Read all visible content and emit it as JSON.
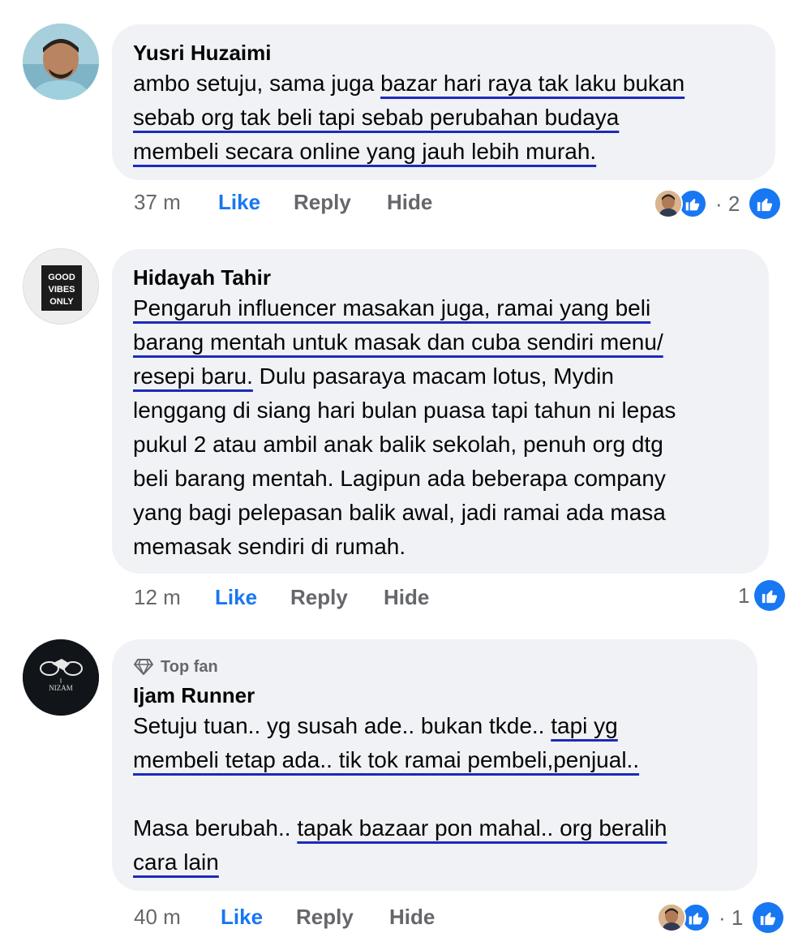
{
  "comments": [
    {
      "author": "Yusri Huzaimi",
      "text_plain_1": "ambo setuju, sama juga ",
      "text_ul_1": "bazar hari raya tak laku bukan",
      "text_ul_2": "sebab org tak beli tapi sebab perubahan budaya ",
      "text_ul_3": "membeli secara online yang jauh lebih murah.",
      "time": "37 m",
      "like": "Like",
      "reply": "Reply",
      "hide": "Hide",
      "reaction_count": "· 2"
    },
    {
      "author": "Hidayah Tahir",
      "text_ul_1": "Pengaruh influencer masakan juga, ramai yang beli ",
      "text_ul_2": "barang mentah untuk masak dan cuba sendiri menu/",
      "text_ul_3": "resepi baru.",
      "text_plain_3": " Dulu pasaraya macam lotus, Mydin",
      "text_line_4": "lenggang di siang hari bulan puasa tapi tahun ni lepas",
      "text_line_5": "pukul 2 atau ambil anak balik sekolah, penuh org dtg",
      "text_line_6": "beli barang mentah. Lagipun ada beberapa company",
      "text_line_7": "yang bagi pelepasan balik awal, jadi ramai ada masa",
      "text_line_8": "memasak sendiri di rumah.",
      "avatar_text_1": "GOOD",
      "avatar_text_2": "VIBES",
      "avatar_text_3": "ONLY",
      "time": "12 m",
      "like": "Like",
      "reply": "Reply",
      "hide": "Hide",
      "reaction_count": "1"
    },
    {
      "badge": "Top fan",
      "author": "Ijam Runner",
      "text_plain_1": "Setuju tuan.. yg susah ade.. bukan tkde.. ",
      "text_ul_1": "tapi yg ",
      "text_ul_2": "membeli tetap ada.. tik tok ramai pembeli,penjual.. ",
      "text_plain_3": "Masa berubah.. ",
      "text_ul_3": "tapak bazaar pon mahal.. org beralih",
      "text_ul_4": "cara lain",
      "avatar_text": "NIZAM",
      "time": "40 m",
      "like": "Like",
      "reply": "Reply",
      "hide": "Hide",
      "reaction_count": "· 1"
    }
  ],
  "icons": {
    "like_reaction": "thumbs-up-icon",
    "badge": "diamond-icon"
  },
  "colors": {
    "bubble": "#f0f2f5",
    "like_blue": "#1877f2",
    "underline": "#1c2bb8",
    "secondary": "#65676b"
  }
}
